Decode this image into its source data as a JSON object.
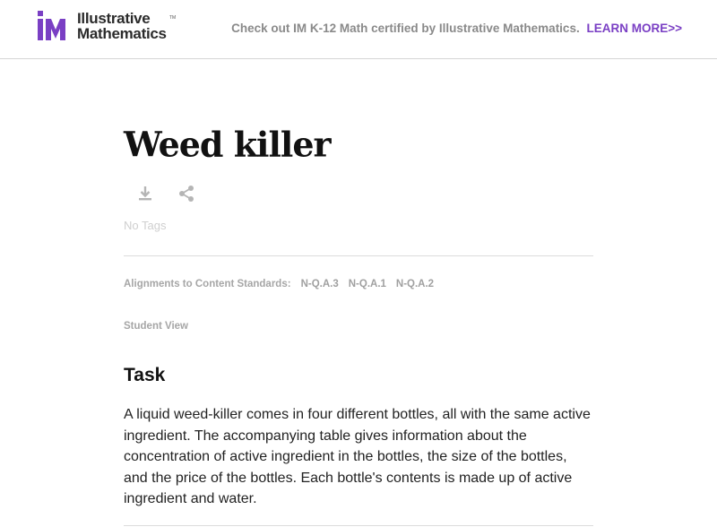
{
  "header": {
    "logo_line1": "Illustrative",
    "logo_line2": "Mathematics",
    "logo_tm": "TM",
    "promo_text": "Check out IM K-12 Math certified by Illustrative Mathematics.",
    "promo_link": "LEARN MORE>>"
  },
  "page": {
    "title": "Weed killer",
    "tags": "No Tags",
    "alignments_label": "Alignments to Content Standards:",
    "standards": [
      "N-Q.A.3",
      "N-Q.A.1",
      "N-Q.A.2"
    ],
    "student_view": "Student View",
    "task_heading": "Task",
    "task_body": "A liquid weed-killer comes in four different bottles, all with the same active ingredient. The accompanying table gives information about the concentration of active ingredient in the bottles, the size of the bottles, and the price of the bottles. Each bottle's contents is made up of active ingredient and water."
  },
  "colors": {
    "brand_purple": "#7a3fc4",
    "muted_text": "#a6a6a6"
  },
  "icons": [
    "download-icon",
    "share-icon"
  ]
}
